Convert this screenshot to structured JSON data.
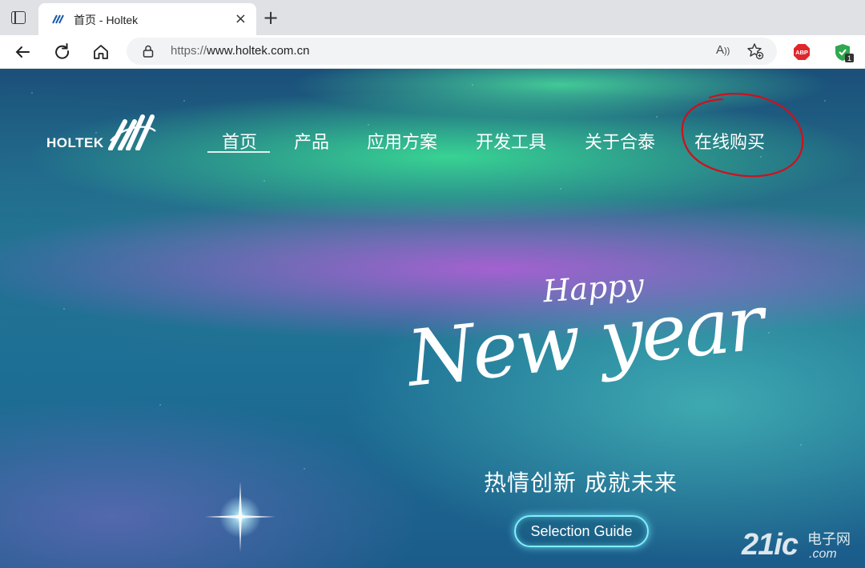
{
  "browser": {
    "tab": {
      "title": "首页 - Holtek",
      "close_glyph": "×"
    },
    "new_tab_glyph": "+",
    "toolbar": {
      "back_icon": "arrow-left-icon",
      "refresh_icon": "refresh-icon",
      "home_icon": "home-icon"
    },
    "address": {
      "scheme": "https://",
      "host": "www.holtek.com.cn"
    },
    "read_aloud_label": "A",
    "extensions": {
      "abp_label": "ABP",
      "shield_badge": "1"
    }
  },
  "site": {
    "logo_text": "HOLTEK",
    "nav": [
      {
        "label": "首页",
        "active": true
      },
      {
        "label": "产品"
      },
      {
        "label": "应用方案"
      },
      {
        "label": "开发工具"
      },
      {
        "label": "关于合泰"
      },
      {
        "label": "在线购买"
      }
    ],
    "hero": {
      "happy": "Happy",
      "new_year": "New year",
      "slogan": "热情创新 成就未来",
      "button": "Selection Guide"
    }
  },
  "watermark": {
    "number": "21ic",
    "cn": "电子网",
    "domain": ".com"
  },
  "colors": {
    "annotation": "#d0101a",
    "button_glow": "#7ff0ff",
    "aurora_green": "#50f0a0",
    "aurora_pink": "#cd5ae6"
  }
}
